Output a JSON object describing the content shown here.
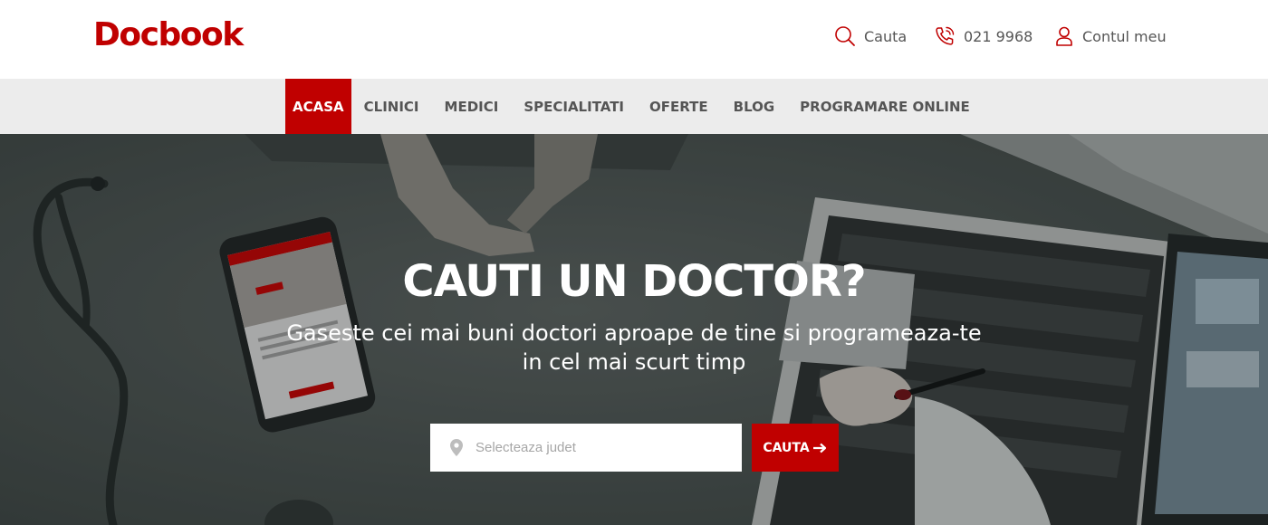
{
  "brand": {
    "name": "Docbook",
    "accent": "#c00000"
  },
  "header": {
    "search": {
      "label": "Cauta",
      "icon": "search-icon"
    },
    "phone": {
      "label": "021 9968",
      "icon": "phone-icon"
    },
    "account": {
      "label": "Contul meu",
      "icon": "user-icon"
    }
  },
  "nav": {
    "items": [
      {
        "label": "ACASA",
        "active": true
      },
      {
        "label": "CLINICI"
      },
      {
        "label": "MEDICI"
      },
      {
        "label": "SPECIALITATI"
      },
      {
        "label": "OFERTE"
      },
      {
        "label": "BLOG"
      },
      {
        "label": "PROGRAMARE ONLINE"
      }
    ]
  },
  "hero": {
    "title": "CAUTI UN DOCTOR?",
    "subtitle_line1": "Gaseste cei mai buni doctori aproape de tine si programeaza-te",
    "subtitle_line2": "in cel mai scurt timp",
    "search": {
      "placeholder": "Selecteaza judet",
      "value": "",
      "icon": "location-pin-icon",
      "button_label": "CAUTA",
      "button_icon": "arrow-right-icon"
    }
  }
}
